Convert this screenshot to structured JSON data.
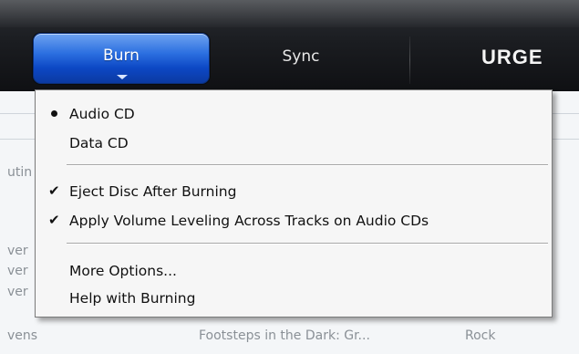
{
  "tabs": {
    "burn": "Burn",
    "sync": "Sync",
    "logo": "URGE"
  },
  "background": {
    "fragments": [
      "utin",
      "ver",
      "ver",
      "ver",
      "vens"
    ],
    "bottom_row_title": "Footsteps in the Dark: Gr...",
    "bottom_row_genre": "Rock"
  },
  "menu": {
    "items": [
      {
        "label": "Audio CD",
        "mark": "bullet"
      },
      {
        "label": "Data CD",
        "mark": "none"
      },
      {
        "label": "Eject Disc After Burning",
        "mark": "check"
      },
      {
        "label": "Apply Volume Leveling Across Tracks on Audio CDs",
        "mark": "check"
      },
      {
        "label": "More Options...",
        "mark": "none"
      },
      {
        "label": "Help with Burning",
        "mark": "none"
      }
    ]
  }
}
